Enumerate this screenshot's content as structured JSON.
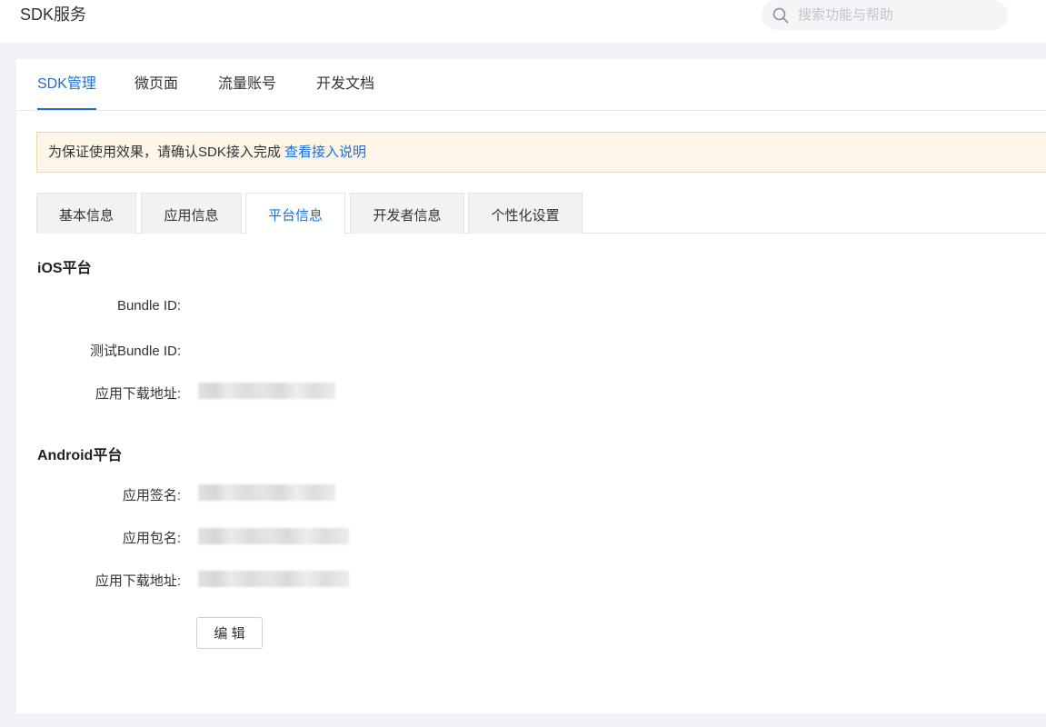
{
  "app": {
    "title": "SDK服务"
  },
  "search": {
    "placeholder": "搜索功能与帮助"
  },
  "top_tabs": [
    {
      "label": "SDK管理",
      "active": true
    },
    {
      "label": "微页面",
      "active": false
    },
    {
      "label": "流量账号",
      "active": false
    },
    {
      "label": "开发文档",
      "active": false
    }
  ],
  "notice": {
    "text": "为保证使用效果，请确认SDK接入完成 ",
    "link": "查看接入说明"
  },
  "sub_tabs": [
    {
      "label": "基本信息",
      "active": false
    },
    {
      "label": "应用信息",
      "active": false
    },
    {
      "label": "平台信息",
      "active": true
    },
    {
      "label": "开发者信息",
      "active": false
    },
    {
      "label": "个性化设置",
      "active": false
    }
  ],
  "ios": {
    "title": "iOS平台",
    "fields": [
      {
        "label": "Bundle ID:",
        "value": ""
      },
      {
        "label": "测试Bundle ID:",
        "value": ""
      },
      {
        "label": "应用下载地址:",
        "value": ""
      }
    ]
  },
  "android": {
    "title": "Android平台",
    "fields": [
      {
        "label": "应用签名:",
        "value": ""
      },
      {
        "label": "应用包名:",
        "value": ""
      },
      {
        "label": "应用下载地址:",
        "value": ""
      }
    ]
  },
  "actions": {
    "edit_label": "编 辑"
  },
  "colors": {
    "accent": "#1f6fd0",
    "notice_bg": "#fdf5e8",
    "page_bg": "#f0f2f5"
  }
}
